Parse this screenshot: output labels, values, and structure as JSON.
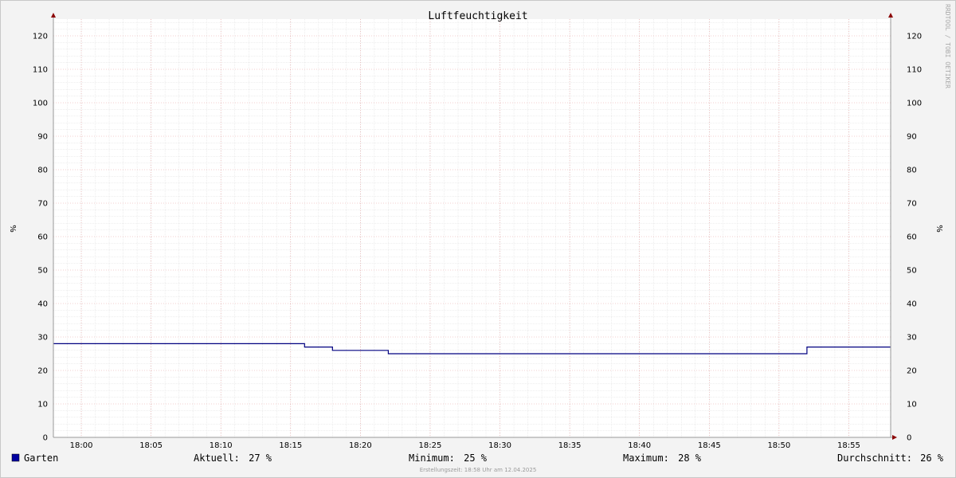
{
  "chart_data": {
    "type": "line",
    "title": "Luftfeuchtigkeit",
    "ylabel": "%",
    "ylim": [
      0,
      125
    ],
    "y_ticks": [
      0,
      10,
      20,
      30,
      40,
      50,
      60,
      70,
      80,
      90,
      100,
      110,
      120
    ],
    "x_ticks": [
      "18:00",
      "18:05",
      "18:10",
      "18:15",
      "18:20",
      "18:25",
      "18:30",
      "18:35",
      "18:40",
      "18:45",
      "18:50",
      "18:55"
    ],
    "x_range": [
      "17:58",
      "18:58"
    ],
    "grid": true,
    "series": [
      {
        "name": "Garten",
        "color": "#000080",
        "step": true,
        "points": [
          [
            "17:58",
            28
          ],
          [
            "18:16",
            27
          ],
          [
            "18:18",
            26
          ],
          [
            "18:22",
            25
          ],
          [
            "18:52",
            27
          ],
          [
            "18:58",
            27
          ]
        ]
      }
    ],
    "watermark": "RRDTOOL / TOBI OETIKER",
    "legend": {
      "swatch_color": "#0000a0",
      "label": "Garten",
      "stats": [
        {
          "key": "current",
          "label": "Aktuell:",
          "value": "27 %"
        },
        {
          "key": "minimum",
          "label": "Minimum:",
          "value": "25 %"
        },
        {
          "key": "maximum",
          "label": "Maximum:",
          "value": "28 %"
        },
        {
          "key": "average",
          "label": "Durchschnitt:",
          "value": "26 %"
        }
      ]
    },
    "footer": "Erstellungszeit: 18:58 Uhr am 12.04.2025"
  }
}
